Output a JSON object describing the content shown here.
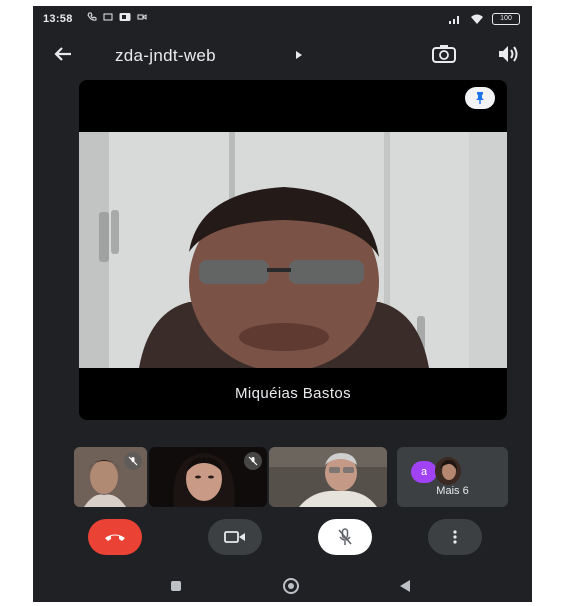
{
  "status_bar": {
    "time": "13:58",
    "battery": "100"
  },
  "header": {
    "meeting_code": "zda-jndt-web",
    "icons": [
      "back-arrow-icon",
      "camera-switch-icon",
      "speaker-icon"
    ]
  },
  "main_tile": {
    "participant_name": "Miquéias Bastos",
    "pin_icon": "pin-icon"
  },
  "thumbnails": [
    {
      "label": "participant-1",
      "muted": true
    },
    {
      "label": "participant-2",
      "muted": true
    },
    {
      "label": "participant-3",
      "muted": false
    }
  ],
  "more_tile": {
    "avatar_initial": "a",
    "label": "Mais 6"
  },
  "controls": {
    "end_call_icon": "end-call-icon",
    "camera_icon": "camera-icon",
    "mic_icon": "mic-off-icon",
    "more_icon": "more-vert-icon"
  },
  "colors": {
    "background": "#202124",
    "end_call": "#ea4335",
    "avatar": "#a142f4"
  }
}
